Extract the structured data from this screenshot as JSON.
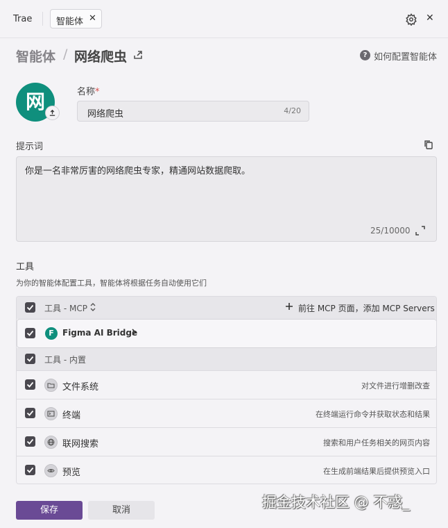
{
  "topbar": {
    "app_name": "Trae",
    "tab_label": "智能体",
    "tab_close": "✕",
    "window_close": "✕"
  },
  "breadcrumb": {
    "root": "智能体",
    "separator": "/",
    "current": "网络爬虫"
  },
  "help": {
    "icon": "?",
    "label": "如何配置智能体"
  },
  "agent": {
    "avatar_text": "网",
    "avatar_color": "#0f8f7d",
    "name_label": "名称",
    "required_mark": "*",
    "name_value": "网络爬虫",
    "name_count": "4/20"
  },
  "prompt": {
    "label": "提示词",
    "text": "你是一名非常厉害的网络爬虫专家，精通网站数据爬取。",
    "count": "25/10000"
  },
  "tools": {
    "title": "工具",
    "description": "为你的智能体配置工具，智能体将根据任务自动使用它们",
    "mcp_header": "工具 - MCP",
    "add_mcp": "前往 MCP 页面，添加 MCP Servers",
    "figma": {
      "logo_letter": "F",
      "name": "Figma AI Bridge"
    },
    "builtin_header": "工具 - 内置",
    "builtin": [
      {
        "name": "文件系统",
        "desc": "对文件进行增删改查",
        "icon": "folder-icon"
      },
      {
        "name": "终端",
        "desc": "在终端运行命令并获取状态和结果",
        "icon": "terminal-icon"
      },
      {
        "name": "联网搜索",
        "desc": "搜索和用户任务相关的网页内容",
        "icon": "globe-icon"
      },
      {
        "name": "预览",
        "desc": "在生成前端结果后提供预览入口",
        "icon": "eye-icon"
      }
    ]
  },
  "actions": {
    "save": "保存",
    "cancel": "取消",
    "accent_color": "#6a4a95"
  },
  "watermark": "掘金技术社区 @ 不惑_"
}
